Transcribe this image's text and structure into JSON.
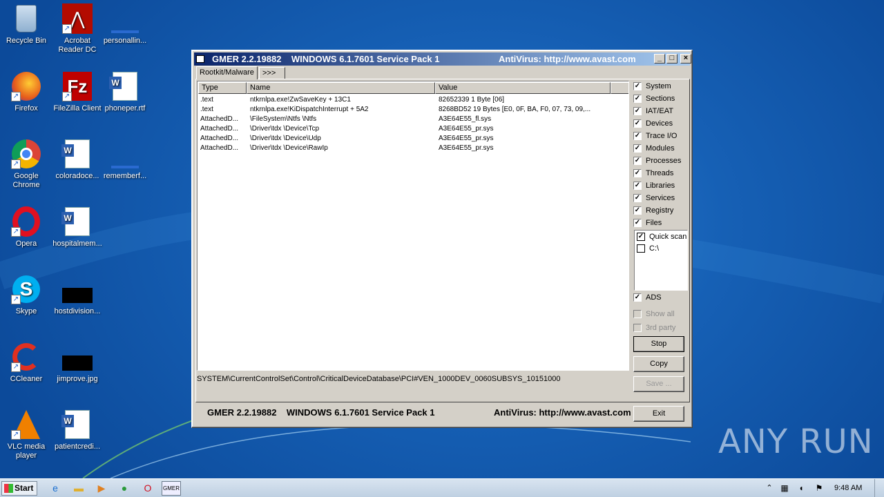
{
  "desktop_icons": [
    {
      "id": "recycle",
      "label": "Recycle Bin",
      "icon": "recycle-bin-icon"
    },
    {
      "id": "acrobat",
      "label": "Acrobat Reader DC",
      "icon": "acrobat-icon"
    },
    {
      "id": "personal",
      "label": "personallin...",
      "icon": "file-icon"
    },
    {
      "id": "firefox",
      "label": "Firefox",
      "icon": "firefox-icon"
    },
    {
      "id": "filezilla",
      "label": "FileZilla Client",
      "icon": "filezilla-icon"
    },
    {
      "id": "phoneper",
      "label": "phoneper.rtf",
      "icon": "word-doc-icon"
    },
    {
      "id": "chrome",
      "label": "Google Chrome",
      "icon": "chrome-icon"
    },
    {
      "id": "colorado",
      "label": "coloradoce...",
      "icon": "word-doc-icon"
    },
    {
      "id": "remember",
      "label": "rememberf...",
      "icon": "file-icon"
    },
    {
      "id": "opera",
      "label": "Opera",
      "icon": "opera-icon"
    },
    {
      "id": "hospital",
      "label": "hospitalmem...",
      "icon": "word-doc-icon"
    },
    {
      "id": "skype",
      "label": "Skype",
      "icon": "skype-icon"
    },
    {
      "id": "hostdiv",
      "label": "hostdivision...",
      "icon": "image-icon"
    },
    {
      "id": "ccleaner",
      "label": "CCleaner",
      "icon": "ccleaner-icon"
    },
    {
      "id": "jimprove",
      "label": "jimprove.jpg",
      "icon": "image-icon"
    },
    {
      "id": "vlc",
      "label": "VLC media player",
      "icon": "vlc-icon"
    },
    {
      "id": "patient",
      "label": "patientcredi...",
      "icon": "word-doc-icon"
    }
  ],
  "window": {
    "title": "GMER 2.2.19882    WINDOWS 6.1.7601 Service Pack 1",
    "title_right": "AntiVirus: http://www.avast.com",
    "tabs": [
      "Rootkit/Malware",
      ">>>"
    ],
    "columns": [
      "Type",
      "Name",
      "Value"
    ],
    "rows": [
      {
        "type": ".text",
        "name": "ntkrnlpa.exe!ZwSaveKey + 13C1",
        "value": "82652339 1 Byte  [06]"
      },
      {
        "type": ".text",
        "name": "ntkrnlpa.exe!KiDispatchInterrupt + 5A2",
        "value": "8268BD52 19 Bytes  [E0, 0F, BA, F0, 07, 73, 09,..."
      },
      {
        "type": "AttachedD...",
        "name": "\\FileSystem\\Ntfs \\Ntfs",
        "value": "A3E64E55_fl.sys"
      },
      {
        "type": "AttachedD...",
        "name": "\\Driver\\tdx \\Device\\Tcp",
        "value": "A3E64E55_pr.sys"
      },
      {
        "type": "AttachedD...",
        "name": "\\Driver\\tdx \\Device\\Udp",
        "value": "A3E64E55_pr.sys"
      },
      {
        "type": "AttachedD...",
        "name": "\\Driver\\tdx \\Device\\RawIp",
        "value": "A3E64E55_pr.sys"
      }
    ],
    "checks": [
      {
        "label": "System",
        "checked": true
      },
      {
        "label": "Sections",
        "checked": true
      },
      {
        "label": "IAT/EAT",
        "checked": true
      },
      {
        "label": "Devices",
        "checked": true
      },
      {
        "label": "Trace I/O",
        "checked": true
      },
      {
        "label": "Modules",
        "checked": true
      },
      {
        "label": "Processes",
        "checked": true
      },
      {
        "label": "Threads",
        "checked": true
      },
      {
        "label": "Libraries",
        "checked": true
      },
      {
        "label": "Services",
        "checked": true
      },
      {
        "label": "Registry",
        "checked": true
      },
      {
        "label": "Files",
        "checked": true
      }
    ],
    "scan_targets": [
      {
        "label": "Quick scan",
        "checked": true
      },
      {
        "label": "C:\\",
        "checked": false
      }
    ],
    "ads": {
      "label": "ADS",
      "checked": true
    },
    "show_all": {
      "label": "Show all",
      "checked": false
    },
    "third_party": {
      "label": "3rd party",
      "checked": false
    },
    "buttons": {
      "stop": "Stop",
      "copy": "Copy",
      "save": "Save ...",
      "exit": "Exit"
    },
    "status": "SYSTEM\\CurrentControlSet\\Control\\CriticalDeviceDatabase\\PCI#VEN_1000DEV_0060SUBSYS_10151000",
    "footer": "GMER 2.2.19882    WINDOWS 6.1.7601 Service Pack 1",
    "footer_right": "AntiVirus: http://www.avast.com"
  },
  "taskbar": {
    "start": "Start",
    "clock": "9:48 AM"
  },
  "watermark": "ANY RUN"
}
